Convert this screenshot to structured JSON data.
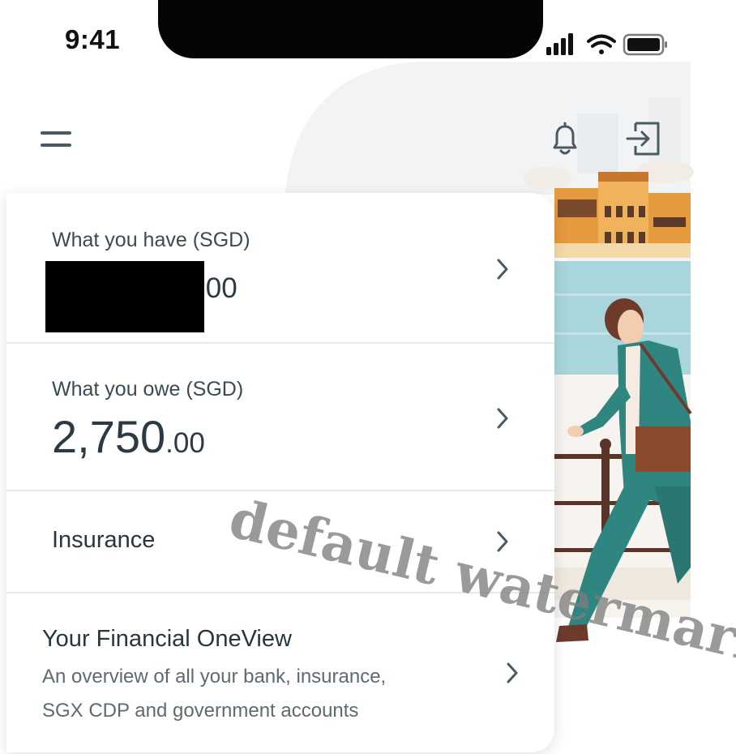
{
  "status_bar": {
    "time": "9:41",
    "icons": [
      "signal-icon",
      "wifi-icon",
      "battery-icon"
    ]
  },
  "header": {
    "icons": [
      "menu-icon",
      "bell-icon",
      "logout-icon"
    ]
  },
  "accounts": {
    "have": {
      "label": "What you have (SGD)",
      "amount_visible": ".00",
      "redacted": true
    },
    "owe": {
      "label": "What you owe (SGD)",
      "amount_main": "2,750",
      "amount_cents": ".00"
    },
    "insurance": {
      "label": "Insurance"
    },
    "oneview": {
      "title": "Your Financial OneView",
      "line1": "An overview of all your bank, insurance,",
      "line2": "SGX CDP and government accounts"
    }
  },
  "watermark": "default watermark",
  "colors": {
    "accent_teal": "#2f8580",
    "building_orange": "#e49a3d",
    "text_dark": "#27363f",
    "text_muted": "#5d6a72",
    "divider": "#e6e9eb"
  }
}
